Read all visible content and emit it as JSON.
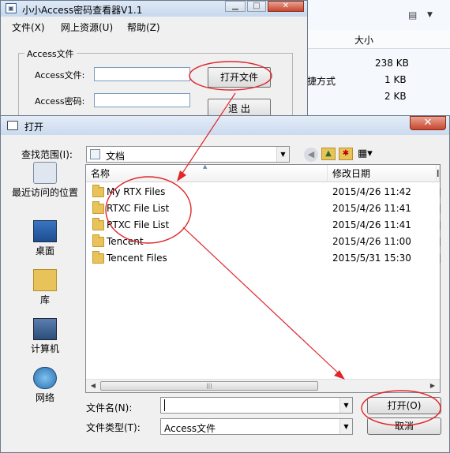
{
  "bg_explorer": {
    "view_icon": "view-options-icon",
    "size_header": "大小",
    "rows": [
      {
        "name": "",
        "size": "238 KB"
      },
      {
        "name": "捷方式",
        "size": "1 KB"
      },
      {
        "name": "",
        "size": "2 KB"
      }
    ]
  },
  "app": {
    "title": "小小Access密码查看器V1.1",
    "menu": [
      "文件(X)",
      "网上资源(U)",
      "帮助(Z)"
    ],
    "group_title": "Access文件",
    "file_label": "Access文件:",
    "password_label": "Access密码:",
    "open_button": "打开文件",
    "exit_button": "退 出",
    "win_controls": [
      "▁",
      "□",
      "✕"
    ]
  },
  "dialog": {
    "title": "打开",
    "close": "✕",
    "lookin_label": "查找范围(I):",
    "lookin_value": "文档",
    "places": [
      "最近访问的位置",
      "桌面",
      "库",
      "计算机",
      "网络"
    ],
    "columns": [
      "名称",
      "修改日期",
      "I"
    ],
    "files": [
      {
        "name": "My RTX Files",
        "date": "2015/4/26 11:42"
      },
      {
        "name": "RTXC File List",
        "date": "2015/4/26 11:41"
      },
      {
        "name": "RTXC File List",
        "date": "2015/4/26 11:41"
      },
      {
        "name": "Tencent",
        "date": "2015/4/26 11:00"
      },
      {
        "name": "Tencent Files",
        "date": "2015/5/31 15:30"
      }
    ],
    "filename_label": "文件名(N):",
    "filename_value": "",
    "filetype_label": "文件类型(T):",
    "filetype_value": "Access文件",
    "open_button": "打开(O)",
    "cancel_button": "取消"
  },
  "colors": {
    "annotation": "#e0262b",
    "folder": "#e8c35a"
  }
}
